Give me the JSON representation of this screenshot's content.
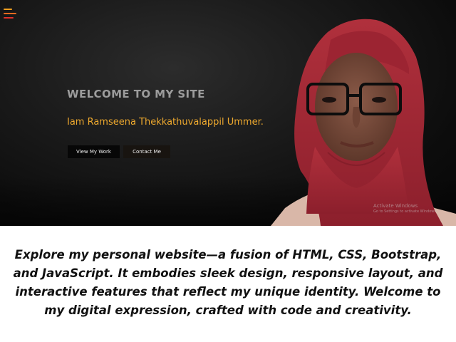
{
  "hero": {
    "welcome": "WELCOME TO MY SITE",
    "name": "Iam Ramseena Thekkathuvalappil Ummer.",
    "buttons": {
      "work": "View My Work",
      "contact": "Contact Me"
    },
    "watermark": {
      "line1": "Activate Windows",
      "line2": "Go to Settings to activate Windows."
    }
  },
  "caption": "Explore my personal website—a fusion of HTML, CSS, Bootstrap, and JavaScript. It embodies sleek design, responsive layout, and interactive features that reflect my unique identity. Welcome to my digital expression, crafted with code and creativity.",
  "icons": {
    "menu": "hamburger-menu-icon"
  },
  "colors": {
    "accent_orange": "#eea92e",
    "menu_lines": [
      "#f0a020",
      "#e46a20",
      "#e0302a"
    ],
    "welcome_text": "#9c9c9c",
    "hero_background": "#141414"
  }
}
